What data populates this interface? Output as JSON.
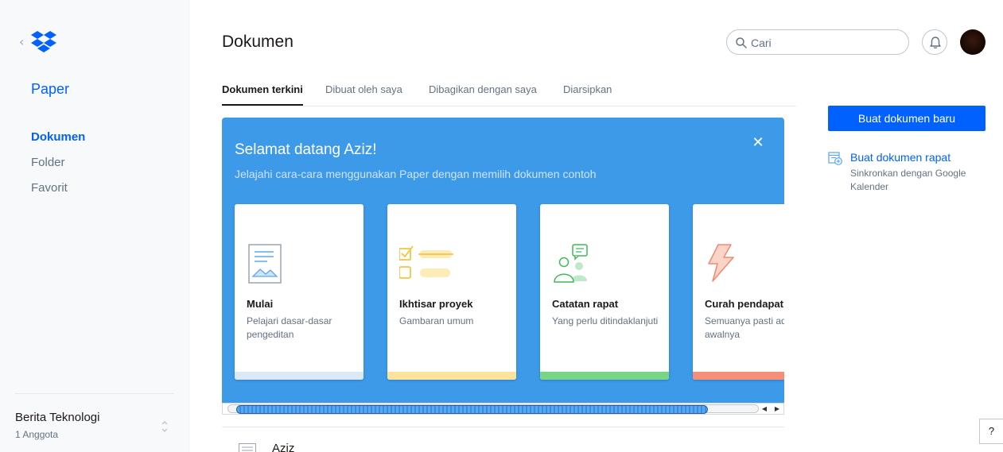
{
  "app": {
    "brand": "Paper",
    "page_title": "Dokumen"
  },
  "sidebar": {
    "nav": [
      {
        "label": "Dokumen",
        "active": true
      },
      {
        "label": "Folder",
        "active": false
      },
      {
        "label": "Favorit",
        "active": false
      }
    ],
    "team": {
      "name": "Berita Teknologi",
      "members": "1 Anggota"
    }
  },
  "header": {
    "search_placeholder": "Cari"
  },
  "tabs": [
    {
      "label": "Dokumen terkini",
      "active": true
    },
    {
      "label": "Dibuat oleh saya",
      "active": false
    },
    {
      "label": "Dibagikan dengan saya",
      "active": false
    },
    {
      "label": "Diarsipkan",
      "active": false
    }
  ],
  "welcome": {
    "title": "Selamat datang Aziz!",
    "subtitle": "Jelajahi cara-cara menggunakan Paper dengan memilih dokumen contoh",
    "cards": [
      {
        "title": "Mulai",
        "desc": "Pelajari dasar-dasar pengeditan",
        "icon": "document-image-icon",
        "stripe_color": "#dbe8f5"
      },
      {
        "title": "Ikhtisar proyek",
        "desc": "Gambaran umum",
        "icon": "checklist-icon",
        "stripe_color": "#fde49c"
      },
      {
        "title": "Catatan rapat",
        "desc": "Yang perlu ditindaklanjuti",
        "icon": "people-chat-icon",
        "stripe_color": "#76d587"
      },
      {
        "title": "Curah pendapat",
        "desc": "Semuanya pasti ada awalnya",
        "icon": "lightning-icon",
        "stripe_color": "#f58f79"
      }
    ]
  },
  "documents": [
    {
      "title": "Aziz"
    }
  ],
  "right_panel": {
    "new_doc_label": "Buat dokumen baru",
    "meeting_link": "Buat dokumen rapat",
    "meeting_sub": "Sinkronkan dengan Google Kalender"
  },
  "help_label": "?",
  "colors": {
    "accent": "#0061fe",
    "welcome_bg": "#3d9ae8",
    "sidebar_bg": "#f7f9fa"
  }
}
